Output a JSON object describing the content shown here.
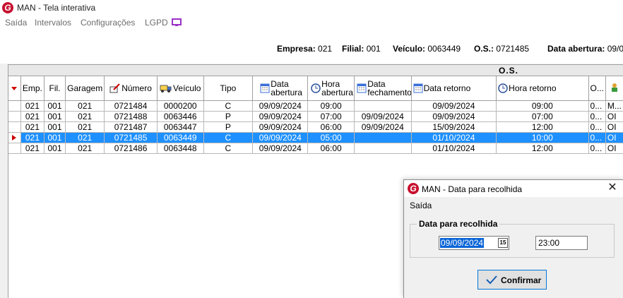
{
  "window": {
    "title": "MAN - Tela interativa"
  },
  "menu": {
    "items": [
      "Saída",
      "Intervalos",
      "Configurações",
      "LGPD"
    ]
  },
  "info": {
    "empresa_label": "Empresa:",
    "empresa": "021",
    "filial_label": "Filial:",
    "filial": "001",
    "veiculo_label": "Veículo:",
    "veiculo": "0063449",
    "os_label": "O.S.:",
    "os": "0721485",
    "data_abertura_label": "Data abertura:",
    "data_abertura": "09/0"
  },
  "grid": {
    "group_label": "O.S.",
    "columns": [
      "Emp.",
      "Fil.",
      "Garagem",
      "Número",
      "Veículo",
      "Tipo",
      "Data abertura",
      "Hora abertura",
      "Data fechamento",
      "Data retorno",
      "Hora retorno",
      "O...",
      ""
    ],
    "rows": [
      {
        "emp": "021",
        "fil": "001",
        "garagem": "021",
        "numero": "0721484",
        "veiculo": "0000200",
        "tipo": "C",
        "data_abertura": "09/09/2024",
        "hora_abertura": "09:00",
        "data_fechamento": "",
        "data_retorno": "09/09/2024",
        "hora_retorno": "09:00",
        "o": "0...",
        "last": "M..."
      },
      {
        "emp": "021",
        "fil": "001",
        "garagem": "021",
        "numero": "0721488",
        "veiculo": "0063446",
        "tipo": "P",
        "data_abertura": "09/09/2024",
        "hora_abertura": "07:00",
        "data_fechamento": "09/09/2024",
        "data_retorno": "09/09/2024",
        "hora_retorno": "07:00",
        "o": "0...",
        "last": "OI"
      },
      {
        "emp": "021",
        "fil": "001",
        "garagem": "021",
        "numero": "0721487",
        "veiculo": "0063447",
        "tipo": "P",
        "data_abertura": "09/09/2024",
        "hora_abertura": "06:00",
        "data_fechamento": "09/09/2024",
        "data_retorno": "15/09/2024",
        "hora_retorno": "12:00",
        "o": "0...",
        "last": "OI"
      },
      {
        "emp": "021",
        "fil": "001",
        "garagem": "021",
        "numero": "0721485",
        "veiculo": "0063449",
        "tipo": "C",
        "data_abertura": "09/09/2024",
        "hora_abertura": "05:00",
        "data_fechamento": "",
        "data_retorno": "01/10/2024",
        "hora_retorno": "10:00",
        "o": "0...",
        "last": "OI"
      },
      {
        "emp": "021",
        "fil": "001",
        "garagem": "021",
        "numero": "0721486",
        "veiculo": "0063448",
        "tipo": "C",
        "data_abertura": "09/09/2024",
        "hora_abertura": "06:00",
        "data_fechamento": "",
        "data_retorno": "01/10/2024",
        "hora_retorno": "12:00",
        "o": "0...",
        "last": "OI"
      }
    ]
  },
  "dialog": {
    "title": "MAN -  Data para recolhida",
    "menu": "Saída",
    "group_label": "Data para recolhida",
    "date_value": "09/09/2024",
    "calendar_glyph": "15",
    "time_value": "23:00",
    "confirm_label": "Confirmar"
  },
  "colors": {
    "brand": "#c8102e",
    "selection": "#1e90ff",
    "accent": "#0078d7"
  }
}
